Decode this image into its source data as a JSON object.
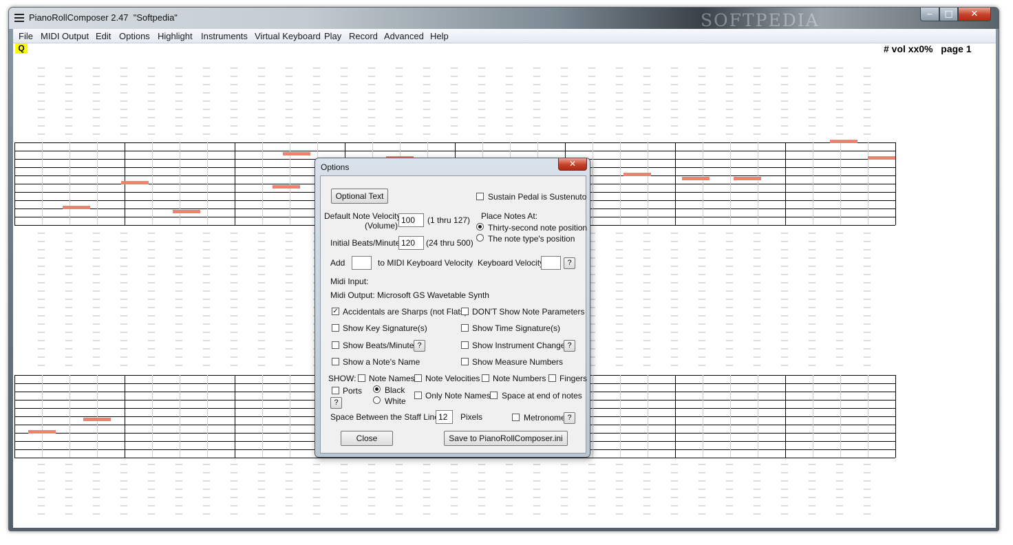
{
  "window": {
    "title": "PianoRollComposer 2.47  \"Softpedia\"",
    "watermark": "SOFTPEDIA",
    "controls": {
      "minimize": "‒",
      "maximize": "□",
      "close": "✕"
    }
  },
  "menu": [
    "File",
    "MIDI Output",
    "Edit",
    "Options",
    "Highlight",
    "Instruments",
    "Virtual Keyboard",
    "Play",
    "Record",
    "Advanced",
    "Help"
  ],
  "status": {
    "q_badge": "Q",
    "right": "# vol xx0%   page 1"
  },
  "colors": {
    "note": "#f08070",
    "q_badge": "#ffff00",
    "grid": "#000000",
    "dash": "#b8b8b8"
  },
  "dialog": {
    "title": "Options",
    "close_glyph": "✕",
    "optional_text_button": "Optional Text",
    "sustain_pedal": {
      "label": "Sustain Pedal is Sustenuto",
      "checked": false
    },
    "default_velocity": {
      "label": "Default Note Velocity",
      "sublabel": "(Volume)",
      "value": "100",
      "range": "(1 thru 127)"
    },
    "initial_bpm": {
      "label": "Initial Beats/Minute",
      "value": "120",
      "range": "(24 thru 500)"
    },
    "place_notes": {
      "label": "Place Notes At:",
      "options": [
        {
          "label": "Thirty-second note position",
          "selected": true
        },
        {
          "label": "The note type's position",
          "selected": false
        }
      ]
    },
    "add_velocity": {
      "prefix": "Add",
      "suffix": "to MIDI Keyboard Velocity",
      "value": ""
    },
    "keyboard_velocity": {
      "label": "Keyboard Velocity",
      "value": ""
    },
    "help_glyph": "?",
    "midi_input": "Midi Input:",
    "midi_output": "Midi Output: Microsoft GS Wavetable Synth",
    "checks_left": [
      {
        "label": "Accidentals are Sharps (not Flats)",
        "checked": true
      },
      {
        "label": "Show Key Signature(s)",
        "checked": false
      },
      {
        "label": "Show Beats/Minute",
        "checked": false
      },
      {
        "label": "Show a Note's Name",
        "checked": false
      }
    ],
    "checks_right": [
      {
        "label": "DON'T Show Note Parameters",
        "checked": false
      },
      {
        "label": "Show Time Signature(s)",
        "checked": false
      },
      {
        "label": "Show Instrument Changes",
        "checked": false
      },
      {
        "label": "Show Measure Numbers",
        "checked": false
      }
    ],
    "show_label": "SHOW:",
    "show_options": [
      {
        "label": "Note Names",
        "checked": false
      },
      {
        "label": "Note Velocities",
        "checked": false
      },
      {
        "label": "Note Numbers",
        "checked": false
      },
      {
        "label": "Fingers",
        "checked": false
      }
    ],
    "ports": {
      "label": "Ports",
      "checked": false
    },
    "color_options": [
      {
        "label": "Black",
        "selected": true
      },
      {
        "label": "White",
        "selected": false
      }
    ],
    "only_note_names": {
      "label": "Only Note Names",
      "checked": false
    },
    "space_end": {
      "label": "Space at end of notes",
      "checked": false
    },
    "staff_spacing": {
      "label": "Space Between the Staff Lines",
      "value": "12",
      "unit": "Pixels"
    },
    "metronome": {
      "label": "Metronome",
      "checked": false
    },
    "close_button": "Close",
    "save_button": "Save to PianoRollComposer.ini"
  }
}
